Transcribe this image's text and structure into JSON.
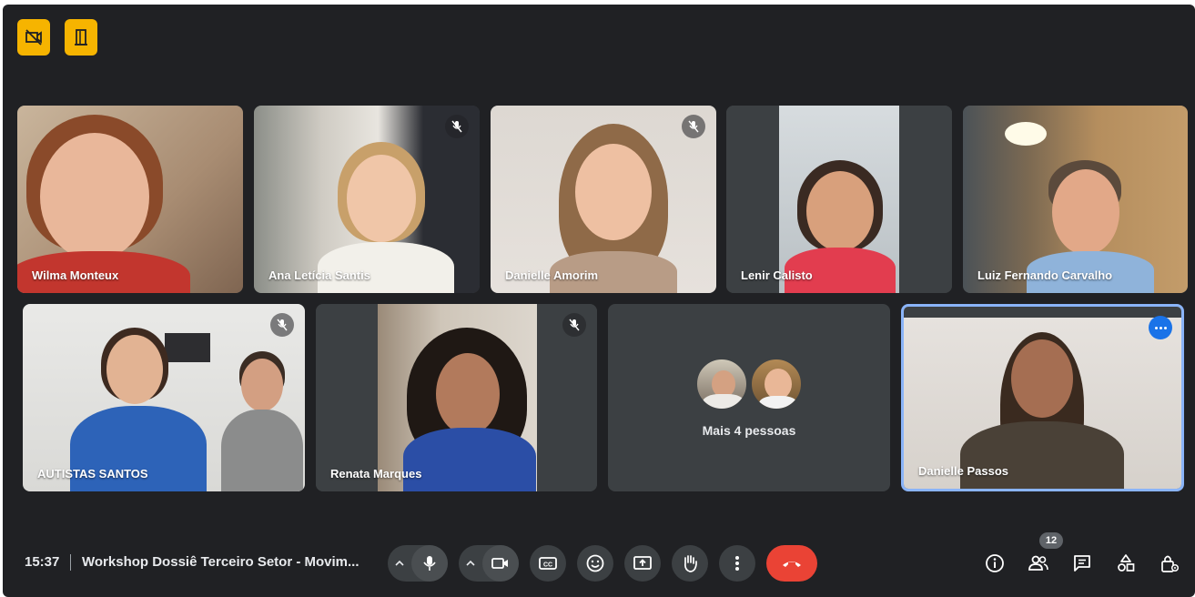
{
  "participants": [
    {
      "name": "Wilma Monteux",
      "muted": false
    },
    {
      "name": "Ana Letícia Santis",
      "muted": true
    },
    {
      "name": "Danielle Amorim",
      "muted": true
    },
    {
      "name": "Lenir Calisto",
      "muted": false
    },
    {
      "name": "Luiz Fernando Carvalho",
      "muted": false
    },
    {
      "name": "AUTISTAS SANTOS",
      "muted": true
    },
    {
      "name": "Renata Marques",
      "muted": true
    }
  ],
  "more_tile": {
    "label": "Mais 4 pessoas"
  },
  "self_tile": {
    "name": "Danielle Passos"
  },
  "bottom_bar": {
    "time": "15:37",
    "meeting_title": "Workshop Dossiê Terceiro Setor - Movim...",
    "participant_count": "12"
  },
  "colors": {
    "background": "#202124",
    "tile": "#3c4043",
    "badge": "#f6b400",
    "hangup": "#ea4335",
    "accent": "#8ab4f8"
  },
  "icons": {
    "top_left": [
      "no-video-recording-icon",
      "door-icon"
    ],
    "controls": [
      "chevron-up-icon",
      "mic-icon",
      "chevron-up-icon",
      "camera-icon",
      "captions-icon",
      "emoji-icon",
      "present-screen-icon",
      "raise-hand-icon",
      "more-options-icon",
      "hang-up-icon"
    ],
    "right": [
      "info-icon",
      "people-icon",
      "chat-icon",
      "activities-icon",
      "host-controls-icon"
    ]
  }
}
